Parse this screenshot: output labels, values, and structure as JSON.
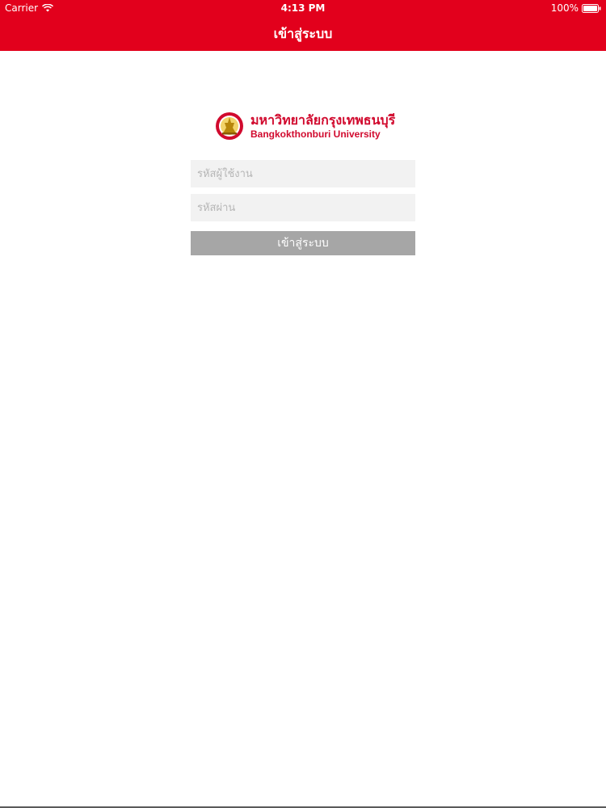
{
  "status_bar": {
    "carrier": "Carrier",
    "time": "4:13 PM",
    "battery": "100%",
    "wifi_icon": "wifi-icon",
    "battery_icon": "battery-icon"
  },
  "nav": {
    "title": "เข้าสู่ระบบ"
  },
  "logo": {
    "thai_name": "มหาวิทยาลัยกรุงเทพธนบุรี",
    "english_name": "Bangkokthonburi University",
    "emblem_icon": "university-emblem-icon"
  },
  "form": {
    "username_placeholder": "รหัสผู้ใช้งาน",
    "username_value": "",
    "password_placeholder": "รหัสผ่าน",
    "password_value": "",
    "login_label": "เข้าสู่ระบบ"
  },
  "colors": {
    "header": "#e2001c",
    "brand_text": "#d10a2e",
    "button": "#a6a6a6",
    "field_bg": "#f2f2f2"
  }
}
